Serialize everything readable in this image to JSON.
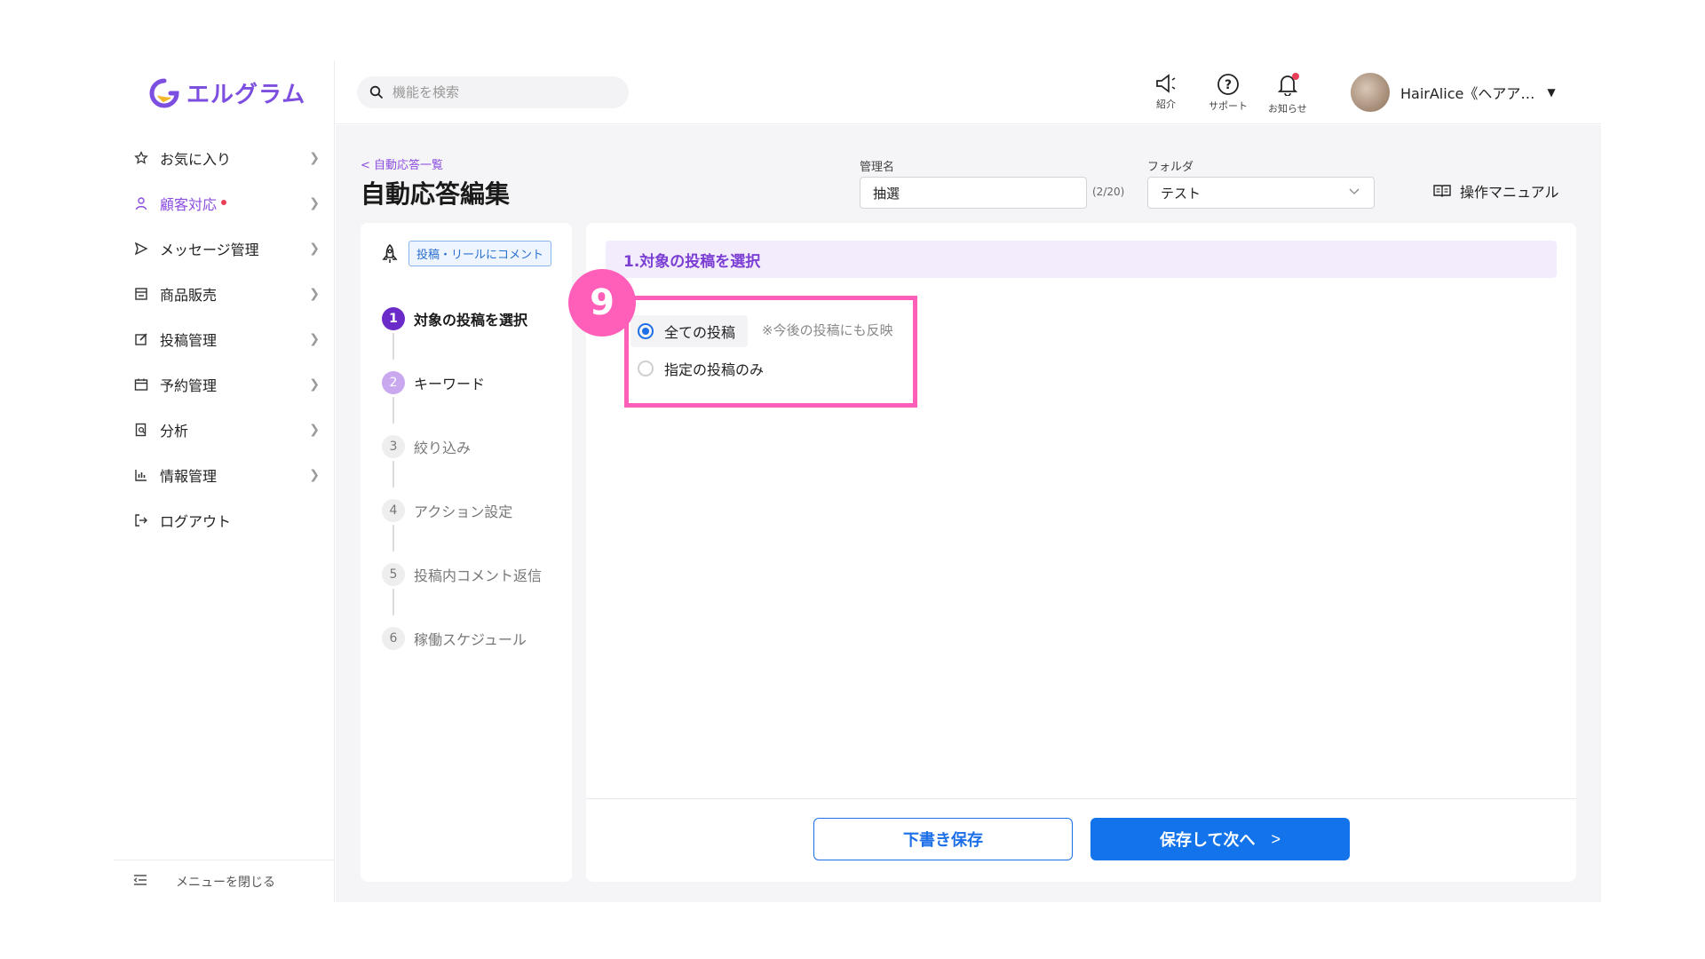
{
  "app": {
    "logo_text": "エルグラム",
    "brand_color": "#7d4fe0"
  },
  "sidebar": {
    "items": [
      {
        "label": "お気に入り",
        "icon": "star-icon"
      },
      {
        "label": "顧客対応",
        "icon": "user-icon",
        "active": true
      },
      {
        "label": "メッセージ管理",
        "icon": "send-icon"
      },
      {
        "label": "商品販売",
        "icon": "store-icon"
      },
      {
        "label": "投稿管理",
        "icon": "edit-icon"
      },
      {
        "label": "予約管理",
        "icon": "calendar-icon"
      },
      {
        "label": "分析",
        "icon": "report-icon"
      },
      {
        "label": "情報管理",
        "icon": "chart-icon"
      },
      {
        "label": "ログアウト",
        "icon": "logout-icon"
      }
    ],
    "close_menu_label": "メニューを閉じる"
  },
  "topbar": {
    "search_placeholder": "機能を検索",
    "referral_label": "紹介",
    "support_label": "サポート",
    "notifications_label": "お知らせ",
    "user_name": "HairAlice《ヘアア…"
  },
  "page": {
    "back_link": "自動応答一覧",
    "title": "自動応答編集",
    "name_label": "管理名",
    "name_value": "抽選",
    "name_counter": "(2/20)",
    "folder_label": "フォルダ",
    "folder_value": "テスト",
    "manual_label": "操作マニュアル"
  },
  "trigger": {
    "tag": "投稿・リールにコメント"
  },
  "steps": [
    {
      "num": "1",
      "label": "対象の投稿を選択",
      "state": "current"
    },
    {
      "num": "2",
      "label": "キーワード",
      "state": "next"
    },
    {
      "num": "3",
      "label": "絞り込み",
      "state": "pending"
    },
    {
      "num": "4",
      "label": "アクション設定",
      "state": "pending"
    },
    {
      "num": "5",
      "label": "投稿内コメント返信",
      "state": "pending"
    },
    {
      "num": "6",
      "label": "稼働スケジュール",
      "state": "pending"
    }
  ],
  "section": {
    "heading": "1.対象の投稿を選択",
    "options": [
      {
        "label": "全ての投稿",
        "checked": true,
        "note": "※今後の投稿にも反映"
      },
      {
        "label": "指定の投稿のみ",
        "checked": false
      }
    ]
  },
  "annotation": {
    "badge_number": "9",
    "color": "#ff5fb8"
  },
  "buttons": {
    "draft": "下書き保存",
    "save_next": "保存して次へ",
    "save_next_arrow": ">"
  }
}
